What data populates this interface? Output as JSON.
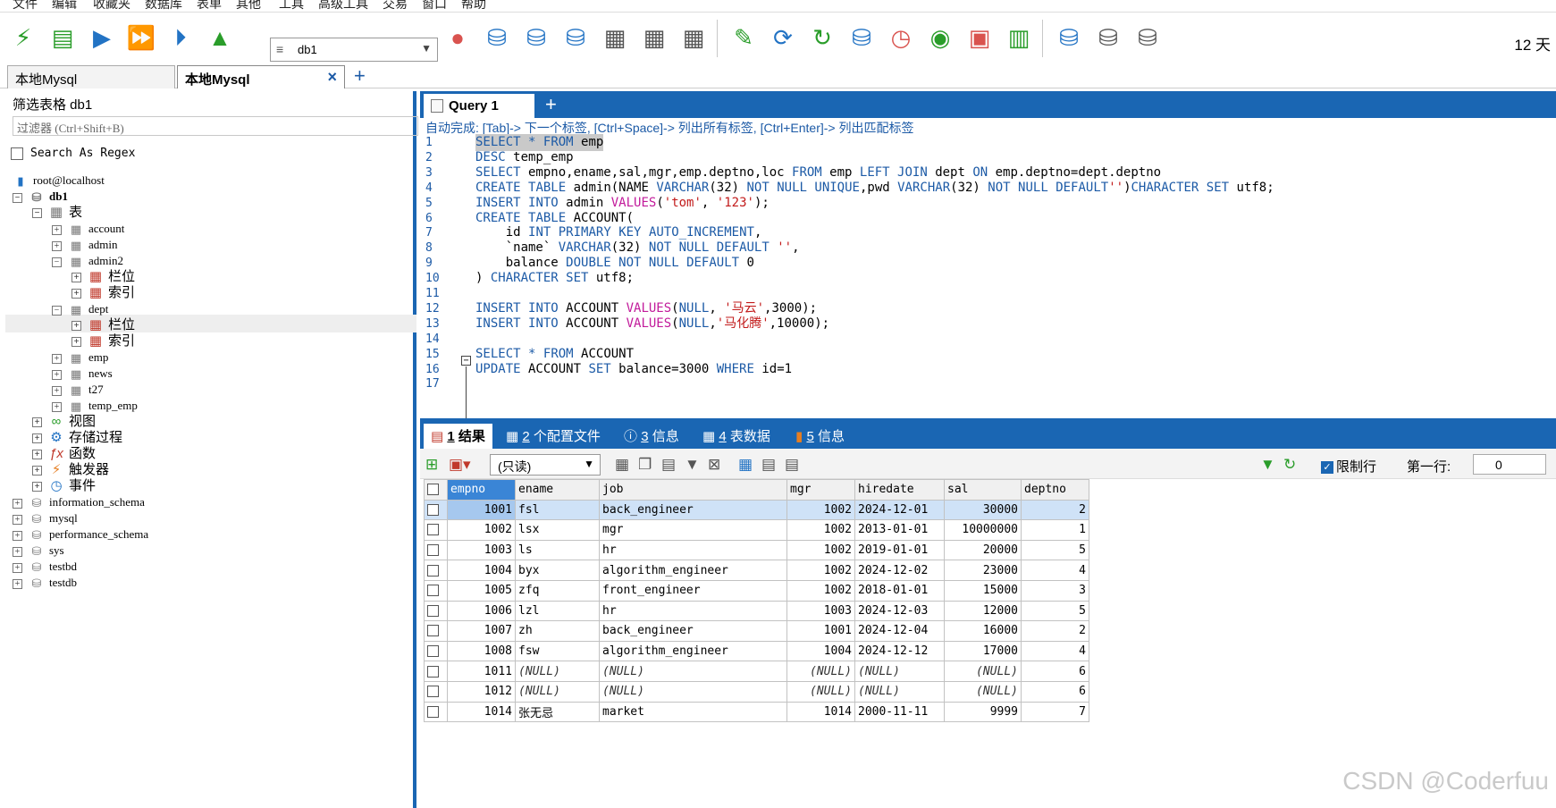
{
  "menubar": [
    "文件",
    "编辑",
    "收藏夹",
    "数据库",
    "表单",
    "其他",
    "工具",
    "高级工具",
    "交易",
    "窗口",
    "帮助"
  ],
  "toolbar": {
    "db_select": "db1",
    "days": "12 天"
  },
  "connection_tabs": [
    {
      "label": "本地Mysql",
      "active": false
    },
    {
      "label": "本地Mysql",
      "active": true
    }
  ],
  "sidebar": {
    "filter_title": "筛选表格 db1",
    "filter_placeholder": "过滤器 (Ctrl+Shift+B)",
    "regex_label": "Search As Regex",
    "connection": "root@localhost",
    "database": "db1",
    "tables_folder": "表",
    "tables": [
      "account",
      "admin",
      "admin2",
      "dept",
      "emp",
      "news",
      "t27",
      "temp_emp"
    ],
    "subnodes": {
      "columns": "栏位",
      "indexes": "索引"
    },
    "folders": [
      "视图",
      "存储过程",
      "函数",
      "触发器",
      "事件"
    ],
    "other_databases": [
      "information_schema",
      "mysql",
      "performance_schema",
      "sys",
      "testbd",
      "testdb"
    ]
  },
  "editor": {
    "query_tab": "Query 1",
    "autocomplete_hint": "自动完成: [Tab]-> 下一个标签, [Ctrl+Space]-> 列出所有标签, [Ctrl+Enter]-> 列出匹配标签",
    "lines": [
      "SELECT * FROM emp",
      "DESC temp_emp",
      "SELECT empno,ename,sal,mgr,emp.deptno,loc FROM emp LEFT JOIN dept ON emp.deptno=dept.deptno",
      "CREATE TABLE admin(NAME VARCHAR(32) NOT NULL UNIQUE,pwd VARCHAR(32) NOT NULL DEFAULT'')CHARACTER SET utf8;",
      "INSERT INTO admin VALUES('tom', '123');",
      "CREATE TABLE ACCOUNT(",
      "    id INT PRIMARY KEY AUTO_INCREMENT,",
      "    `name` VARCHAR(32) NOT NULL DEFAULT '',",
      "    balance DOUBLE NOT NULL DEFAULT 0",
      ") CHARACTER SET utf8;",
      "",
      "INSERT INTO ACCOUNT VALUES(NULL, '马云',3000);",
      "INSERT INTO ACCOUNT VALUES(NULL,'马化腾',10000);",
      "",
      "SELECT * FROM ACCOUNT",
      "UPDATE ACCOUNT SET balance=3000 WHERE id=1",
      ""
    ]
  },
  "result_tabs": [
    {
      "num": "1",
      "label": "结果",
      "active": true
    },
    {
      "num": "2",
      "label": "个配置文件",
      "active": false
    },
    {
      "num": "3",
      "label": "信息",
      "active": false
    },
    {
      "num": "4",
      "label": "表数据",
      "active": false
    },
    {
      "num": "5",
      "label": "信息",
      "active": false
    }
  ],
  "result_toolbar": {
    "mode": "(只读)",
    "limit_label": "限制行",
    "first_row_label": "第一行:",
    "first_row_value": "0"
  },
  "grid": {
    "columns": [
      "empno",
      "ename",
      "job",
      "mgr",
      "hiredate",
      "sal",
      "deptno"
    ],
    "rows": [
      [
        "1001",
        "fsl",
        "back_engineer",
        "1002",
        "2024-12-01",
        "30000",
        "2"
      ],
      [
        "1002",
        "lsx",
        "mgr",
        "1002",
        "2013-01-01",
        "10000000",
        "1"
      ],
      [
        "1003",
        "ls",
        "hr",
        "1002",
        "2019-01-01",
        "20000",
        "5"
      ],
      [
        "1004",
        "byx",
        "algorithm_engineer",
        "1002",
        "2024-12-02",
        "23000",
        "4"
      ],
      [
        "1005",
        "zfq",
        "front_engineer",
        "1002",
        "2018-01-01",
        "15000",
        "3"
      ],
      [
        "1006",
        "lzl",
        "hr",
        "1003",
        "2024-12-03",
        "12000",
        "5"
      ],
      [
        "1007",
        "zh",
        "back_engineer",
        "1001",
        "2024-12-04",
        "16000",
        "2"
      ],
      [
        "1008",
        "fsw",
        "algorithm_engineer",
        "1004",
        "2024-12-12",
        "17000",
        "4"
      ],
      [
        "1011",
        "(NULL)",
        "(NULL)",
        "(NULL)",
        "(NULL)",
        "(NULL)",
        "6"
      ],
      [
        "1012",
        "(NULL)",
        "(NULL)",
        "(NULL)",
        "(NULL)",
        "(NULL)",
        "6"
      ],
      [
        "1014",
        "张无忌",
        "market",
        "1014",
        "2000-11-11",
        "9999",
        "7"
      ]
    ]
  },
  "watermark": "CSDN @Coderfuu",
  "colors": {
    "accent": "#1a66b3",
    "keyword": "#1c5aa6",
    "string": "#c21b1b"
  }
}
